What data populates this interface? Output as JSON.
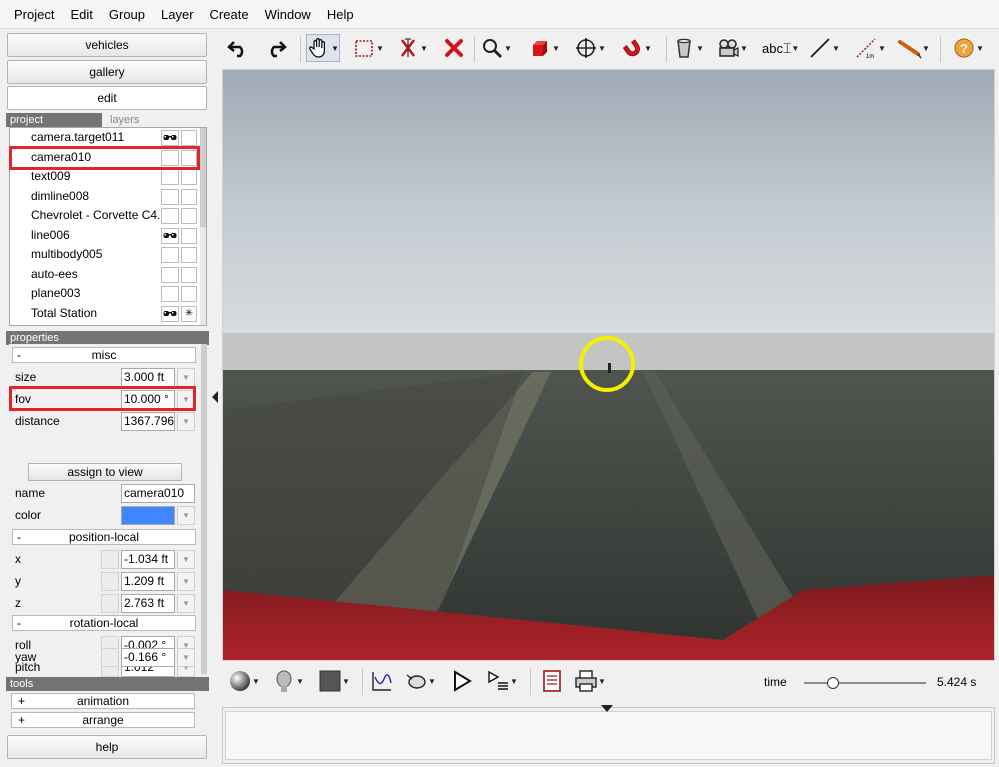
{
  "menu": [
    "Project",
    "Edit",
    "Group",
    "Layer",
    "Create",
    "Window",
    "Help"
  ],
  "left": {
    "buttons": {
      "vehicles": "vehicles",
      "gallery": "gallery",
      "edit": "edit",
      "help": "help"
    },
    "tabs": {
      "project": "project",
      "layers": "layers"
    },
    "objects": [
      {
        "name": "camera.target011",
        "icon1": "glasses-icon",
        "icon2": ""
      },
      {
        "name": "camera010",
        "icon1": "",
        "icon2": ""
      },
      {
        "name": "text009",
        "icon1": "",
        "icon2": ""
      },
      {
        "name": "dimline008",
        "icon1": "",
        "icon2": ""
      },
      {
        "name": "Chevrolet - Corvette C4...",
        "icon1": "",
        "icon2": ""
      },
      {
        "name": "line006",
        "icon1": "glasses-icon",
        "icon2": ""
      },
      {
        "name": "multibody005",
        "icon1": "",
        "icon2": ""
      },
      {
        "name": "auto-ees",
        "icon1": "",
        "icon2": ""
      },
      {
        "name": "plane003",
        "icon1": "",
        "icon2": ""
      },
      {
        "name": "Total Station",
        "icon1": "glasses-icon",
        "icon2": "asterisk-icon"
      }
    ],
    "properties_header": "properties",
    "groups": {
      "misc": "misc",
      "position": "position-local",
      "rotation": "rotation-local"
    },
    "minus": "-",
    "props": {
      "size": {
        "label": "size",
        "value": "3.000 ft"
      },
      "fov": {
        "label": "fov",
        "value": "10.000 °"
      },
      "distance": {
        "label": "distance",
        "value": "1367.796 ft"
      },
      "assign": "assign to view",
      "name": {
        "label": "name",
        "value": "camera010"
      },
      "color": {
        "label": "color",
        "value": "#3f86ff"
      },
      "x": {
        "label": "x",
        "value": "-1.034 ft"
      },
      "y": {
        "label": "y",
        "value": "1.209 ft"
      },
      "z": {
        "label": "z",
        "value": "2.763 ft"
      },
      "roll": {
        "label": "roll",
        "value": "-0.002 °"
      },
      "pitch": {
        "label": "pitch",
        "value": "1.012 °"
      },
      "yaw": {
        "label": "yaw",
        "value": "-0.166 °"
      }
    },
    "tools_header": "tools",
    "tools": [
      {
        "sign": "+",
        "label": "animation"
      },
      {
        "sign": "+",
        "label": "arrange"
      }
    ]
  },
  "toolbar_icons": [
    "undo-icon",
    "redo-icon",
    "pan-hand-icon",
    "select-box-icon",
    "cut-icon",
    "delete-icon",
    "zoom-icon",
    "cube-icon",
    "move-icon",
    "magnet-icon",
    "bucket-icon",
    "camera-icon",
    "text-label-icon",
    "line-icon",
    "measure-icon",
    "tape-measure-icon",
    "help-icon"
  ],
  "toolbar_text": {
    "abc": "abc"
  },
  "bottom": {
    "time_label": "time",
    "time_value": "5.424 s",
    "time_position": 0.24
  },
  "colors": {
    "highlight": "#e3242b",
    "target_circle": "#f5ef00",
    "car_hood": "#8b1a20"
  }
}
